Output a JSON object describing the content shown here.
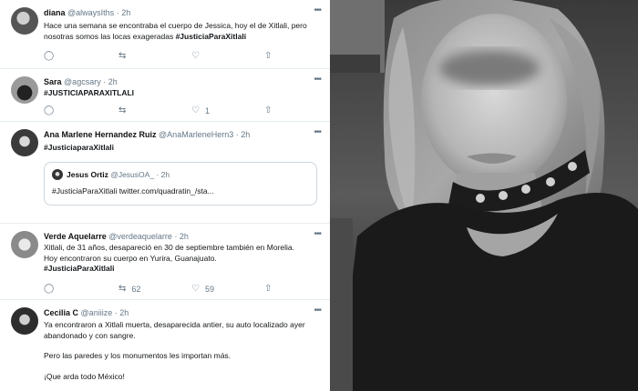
{
  "tweets": [
    {
      "name": "diana",
      "handle": "@alwaysIths",
      "time": "· 2h",
      "text": "Hace una semana se encontraba el cuerpo de Jessica, hoy el de Xitlali, pero nosotras somos las locas exageradas ",
      "hashtag": "#JusticiaParaXitlali",
      "reply_count": "",
      "retweet_count": "",
      "like_count": ""
    },
    {
      "name": "Sara",
      "handle": "@agcsary",
      "time": "· 2h",
      "hashtag": "#JUSTICIAPARAXITLALI",
      "reply_count": "",
      "retweet_count": "",
      "like_count": "1"
    },
    {
      "name": "Ana Marlene Hernandez Ruiz",
      "handle": "@AnaMarleneHern3",
      "time": "· 2h",
      "hashtag": "#JusticiaparaXitlali",
      "quote": {
        "name": "Jesus Ortiz",
        "handle": "@JesusOA_",
        "time": "· 2h",
        "text": "#JusticiaParaXitlali twitter.com/quadratin_/sta..."
      }
    },
    {
      "name": "Verde Aquelarre",
      "handle": "@verdeaquelarre",
      "time": "· 2h",
      "line1": "Xitlali, de 31 años, desapareció en 30 de septiembre también en Morelia.",
      "line2": "Hoy encontraron su cuerpo en Yurira, Guanajuato.",
      "hashtag": "#JusticiaParaXitlali",
      "retweet_count": "62",
      "like_count": "59"
    },
    {
      "name": "Cecilia C",
      "handle": "@aniiize",
      "time": "· 2h",
      "line1": "Ya encontraron a Xitlali muerta, desaparecida antier, su auto localizado ayer",
      "line2": "abandonado y con sangre.",
      "line3": "Pero las paredes y los monumentos les importan más.",
      "line4": "¡Que arda todo México!"
    }
  ],
  "icons": {
    "reply": "speech-bubble",
    "retweet": "retweet-arrows",
    "like": "heart",
    "share": "share-arrow",
    "more": "ellipsis"
  }
}
